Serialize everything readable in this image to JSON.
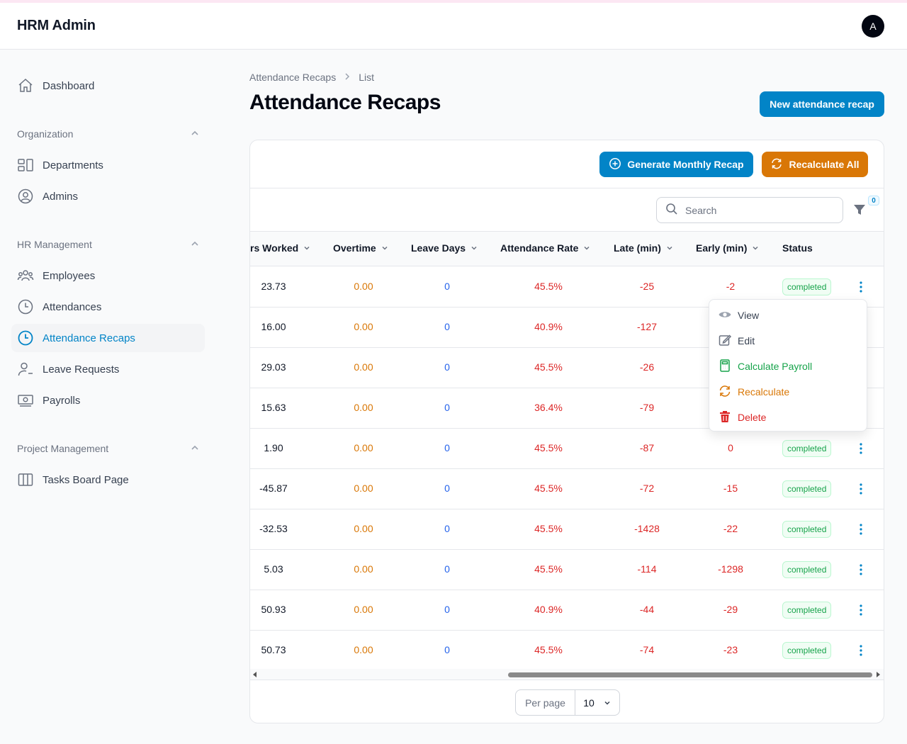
{
  "app": {
    "title": "HRM Admin",
    "avatar_initial": "A"
  },
  "sidebar": {
    "dashboard": "Dashboard",
    "groups": [
      {
        "label": "Organization",
        "items": [
          "Departments",
          "Admins"
        ]
      },
      {
        "label": "HR Management",
        "items": [
          "Employees",
          "Attendances",
          "Attendance Recaps",
          "Leave Requests",
          "Payrolls"
        ]
      },
      {
        "label": "Project Management",
        "items": [
          "Tasks Board Page"
        ]
      }
    ],
    "active": "Attendance Recaps"
  },
  "breadcrumb": {
    "parent": "Attendance Recaps",
    "current": "List"
  },
  "page": {
    "title": "Attendance Recaps",
    "new_button": "New attendance recap"
  },
  "actions": {
    "generate": "Generate Monthly Recap",
    "recalculate_all": "Recalculate All"
  },
  "search": {
    "placeholder": "Search",
    "filter_count": "0"
  },
  "table": {
    "columns": [
      "rs Worked",
      "Overtime",
      "Leave Days",
      "Attendance Rate",
      "Late (min)",
      "Early (min)",
      "Status"
    ],
    "rows": [
      {
        "hours": "23.73",
        "overtime": "0.00",
        "leave": "0",
        "rate": "45.5%",
        "late": "-25",
        "early": "-2",
        "status": "completed"
      },
      {
        "hours": "16.00",
        "overtime": "0.00",
        "leave": "0",
        "rate": "40.9%",
        "late": "-127",
        "early": "",
        "status": ""
      },
      {
        "hours": "29.03",
        "overtime": "0.00",
        "leave": "0",
        "rate": "45.5%",
        "late": "-26",
        "early": "",
        "status": ""
      },
      {
        "hours": "15.63",
        "overtime": "0.00",
        "leave": "0",
        "rate": "36.4%",
        "late": "-79",
        "early": "",
        "status": ""
      },
      {
        "hours": "1.90",
        "overtime": "0.00",
        "leave": "0",
        "rate": "45.5%",
        "late": "-87",
        "early": "0",
        "status": "completed"
      },
      {
        "hours": "-45.87",
        "overtime": "0.00",
        "leave": "0",
        "rate": "45.5%",
        "late": "-72",
        "early": "-15",
        "status": "completed"
      },
      {
        "hours": "-32.53",
        "overtime": "0.00",
        "leave": "0",
        "rate": "45.5%",
        "late": "-1428",
        "early": "-22",
        "status": "completed"
      },
      {
        "hours": "5.03",
        "overtime": "0.00",
        "leave": "0",
        "rate": "45.5%",
        "late": "-114",
        "early": "-1298",
        "status": "completed"
      },
      {
        "hours": "50.93",
        "overtime": "0.00",
        "leave": "0",
        "rate": "40.9%",
        "late": "-44",
        "early": "-29",
        "status": "completed"
      },
      {
        "hours": "50.73",
        "overtime": "0.00",
        "leave": "0",
        "rate": "45.5%",
        "late": "-74",
        "early": "-23",
        "status": "completed"
      }
    ]
  },
  "row_menu": [
    "View",
    "Edit",
    "Calculate Payroll",
    "Recalculate",
    "Delete"
  ],
  "pagination": {
    "per_page_label": "Per page",
    "per_page_value": "10"
  },
  "colors": {
    "primary": "#0284c7",
    "warning": "#d97706",
    "success": "#16a34a",
    "danger": "#dc2626",
    "info": "#2563eb"
  }
}
